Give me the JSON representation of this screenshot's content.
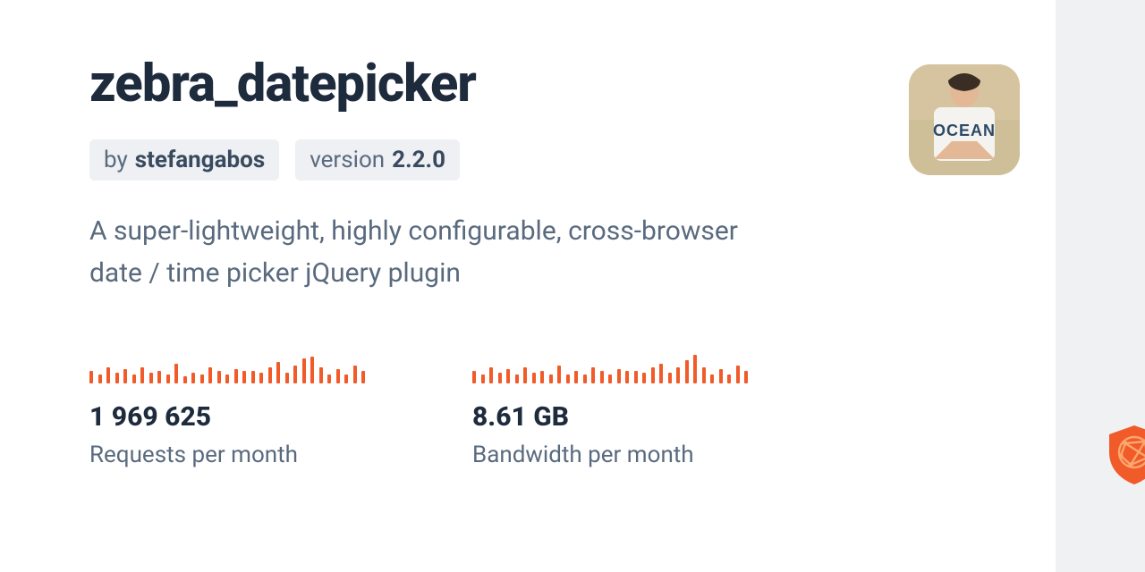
{
  "title": "zebra_datepicker",
  "badges": {
    "by_prefix": "by",
    "author": "stefangabos",
    "version_prefix": "version",
    "version": "2.2.0"
  },
  "description": "A super-lightweight, highly configurable, cross-browser date / time picker jQuery plugin",
  "stats": {
    "requests": {
      "value": "1 969 625",
      "label": "Requests per month"
    },
    "bandwidth": {
      "value": "8.61 GB",
      "label": "Bandwidth per month"
    }
  },
  "chart_data": [
    {
      "type": "bar",
      "title": "Requests per month sparkline",
      "values": [
        14,
        10,
        18,
        12,
        16,
        10,
        18,
        12,
        14,
        10,
        22,
        8,
        12,
        10,
        18,
        14,
        10,
        16,
        14,
        14,
        12,
        18,
        24,
        12,
        20,
        28,
        30,
        18,
        10,
        16,
        10,
        20,
        14
      ],
      "ylim": [
        0,
        44
      ]
    },
    {
      "type": "bar",
      "title": "Bandwidth per month sparkline",
      "values": [
        14,
        10,
        18,
        12,
        16,
        10,
        18,
        12,
        14,
        10,
        20,
        10,
        14,
        10,
        18,
        14,
        10,
        16,
        14,
        14,
        12,
        18,
        22,
        12,
        18,
        26,
        32,
        18,
        10,
        16,
        10,
        20,
        14
      ],
      "ylim": [
        0,
        44
      ]
    }
  ],
  "icons": {
    "shield": "shield-icon",
    "avatar": "avatar"
  }
}
